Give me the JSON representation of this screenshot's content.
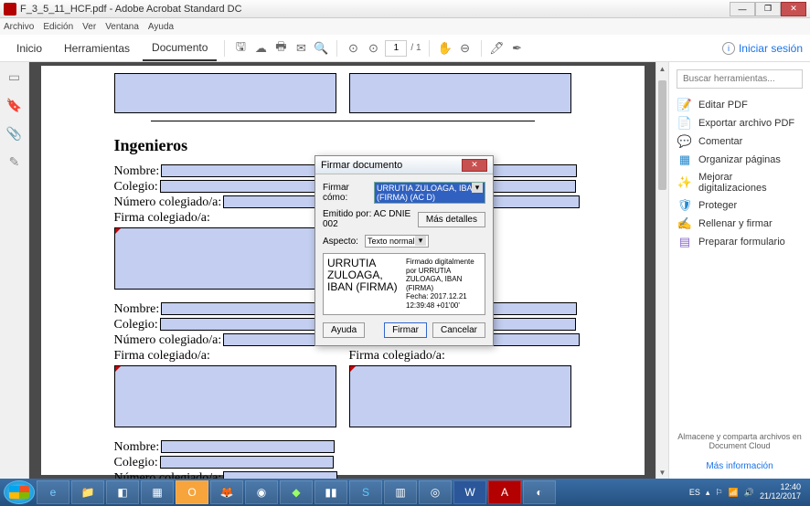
{
  "titlebar": {
    "title": "F_3_5_11_HCF.pdf - Adobe Acrobat Standard DC"
  },
  "menubar": [
    "Archivo",
    "Edición",
    "Ver",
    "Ventana",
    "Ayuda"
  ],
  "toolbar": {
    "tab_inicio": "Inicio",
    "tab_herramientas": "Herramientas",
    "tab_documento": "Documento",
    "page_current": "1",
    "page_total": "/ 1",
    "login": "Iniciar sesión"
  },
  "doc": {
    "section": "Ingenieros",
    "nombre": "Nombre:",
    "colegio": "Colegio:",
    "numcol": "Número colegiado/a:",
    "firmacol": "Firma colegiado/a:"
  },
  "right": {
    "search_ph": "Buscar herramientas...",
    "tools": [
      {
        "icon": "📝",
        "c": "#d44",
        "label": "Editar PDF"
      },
      {
        "icon": "📄",
        "c": "#2a7",
        "label": "Exportar archivo PDF"
      },
      {
        "icon": "💬",
        "c": "#fa0",
        "label": "Comentar"
      },
      {
        "icon": "▦",
        "c": "#28c",
        "label": "Organizar páginas"
      },
      {
        "icon": "✨",
        "c": "#28c",
        "label": "Mejorar digitalizaciones"
      },
      {
        "icon": "🛡",
        "c": "#28c",
        "label": "Proteger"
      },
      {
        "icon": "✍",
        "c": "#86c",
        "label": "Rellenar y firmar"
      },
      {
        "icon": "▤",
        "c": "#86c",
        "label": "Preparar formulario"
      }
    ],
    "cloud": "Almacene y comparta archivos en Document Cloud",
    "more": "Más información"
  },
  "dialog": {
    "title": "Firmar documento",
    "label_firmar": "Firmar cómo:",
    "combo_value": "URRUTIA ZULOAGA, IBAN (FIRMA) (AC D)",
    "emitido": "Emitido por: AC DNIE 002",
    "mas_detalles": "Más detalles",
    "aspecto": "Aspecto:",
    "aspecto_val": "Texto normal",
    "preview_name": "URRUTIA ZULOAGA, IBAN (FIRMA)",
    "preview_meta": "Firmado digitalmente por URRUTIA ZULOAGA, IBAN (FIRMA)\nFecha: 2017.12.21 12:39:48 +01'00'",
    "ayuda": "Ayuda",
    "firmar": "Firmar",
    "cancelar": "Cancelar"
  },
  "tray": {
    "lang": "ES",
    "time": "12:40",
    "date": "21/12/2017"
  }
}
